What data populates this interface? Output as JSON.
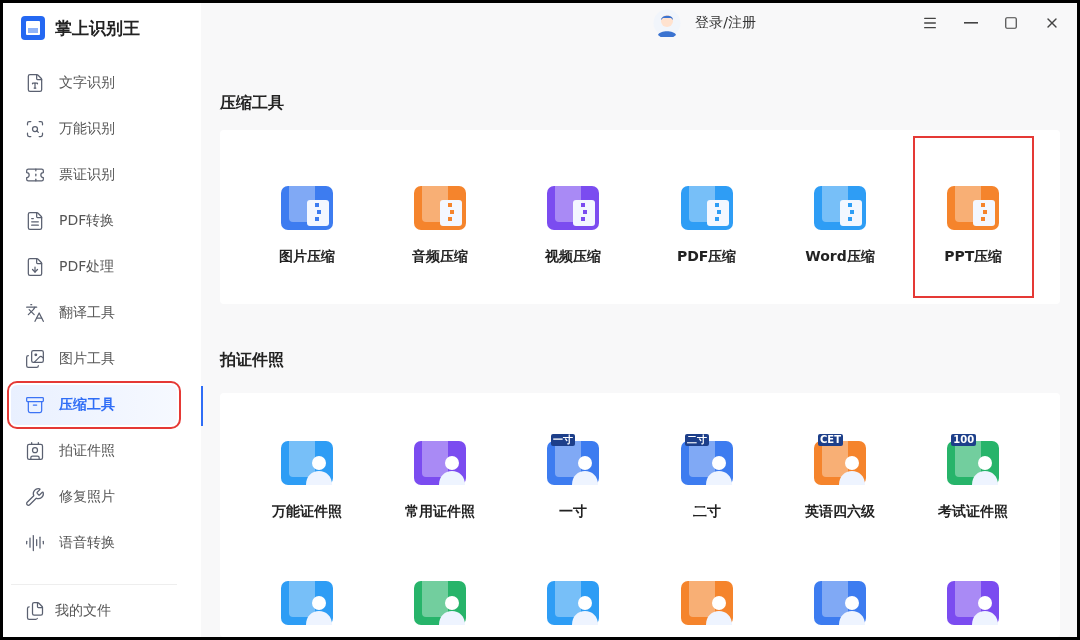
{
  "app": {
    "title": "掌上识别王"
  },
  "sidebar": {
    "items": [
      {
        "label": "文字识别",
        "selected": false,
        "outlined": false
      },
      {
        "label": "万能识别",
        "selected": false,
        "outlined": false
      },
      {
        "label": "票证识别",
        "selected": false,
        "outlined": false
      },
      {
        "label": "PDF转换",
        "selected": false,
        "outlined": false
      },
      {
        "label": "PDF处理",
        "selected": false,
        "outlined": false
      },
      {
        "label": "翻译工具",
        "selected": false,
        "outlined": false
      },
      {
        "label": "图片工具",
        "selected": false,
        "outlined": false
      },
      {
        "label": "压缩工具",
        "selected": true,
        "outlined": true
      },
      {
        "label": "拍证件照",
        "selected": false,
        "outlined": false
      },
      {
        "label": "修复照片",
        "selected": false,
        "outlined": false
      },
      {
        "label": "语音转换",
        "selected": false,
        "outlined": false
      }
    ],
    "footer": {
      "label": "我的文件"
    }
  },
  "header": {
    "login": "登录/注册"
  },
  "sections": [
    {
      "title": "压缩工具",
      "tools": [
        {
          "label": "图片压缩",
          "color": "#3d7cf0",
          "outlined": false
        },
        {
          "label": "音频压缩",
          "color": "#f5842c",
          "outlined": false
        },
        {
          "label": "视频压缩",
          "color": "#7b4cf0",
          "outlined": false
        },
        {
          "label": "PDF压缩",
          "color": "#2e9df5",
          "outlined": false
        },
        {
          "label": "Word压缩",
          "color": "#2e9df5",
          "outlined": false
        },
        {
          "label": "PPT压缩",
          "color": "#f5842c",
          "outlined": true
        }
      ]
    },
    {
      "title": "拍证件照",
      "tools": [
        {
          "label": "万能证件照",
          "color": "#2e9df5",
          "outlined": false
        },
        {
          "label": "常用证件照",
          "color": "#7b4cf0",
          "outlined": false
        },
        {
          "label": "一寸",
          "color": "#3d7cf0",
          "outlined": false,
          "icon_text": "一寸"
        },
        {
          "label": "二寸",
          "color": "#3d7cf0",
          "outlined": false,
          "icon_text": "二寸"
        },
        {
          "label": "英语四六级",
          "color": "#f5842c",
          "outlined": false,
          "icon_text": "CET"
        },
        {
          "label": "考试证件照",
          "color": "#27b46a",
          "outlined": false,
          "icon_text": "100"
        },
        {
          "color": "#2e9df5",
          "outlined": false
        },
        {
          "color": "#27b46a",
          "outlined": false
        },
        {
          "color": "#2e9df5",
          "outlined": false
        },
        {
          "color": "#f5842c",
          "outlined": false
        },
        {
          "color": "#3d7cf0",
          "outlined": false
        },
        {
          "color": "#7b4cf0",
          "outlined": false
        }
      ]
    }
  ]
}
